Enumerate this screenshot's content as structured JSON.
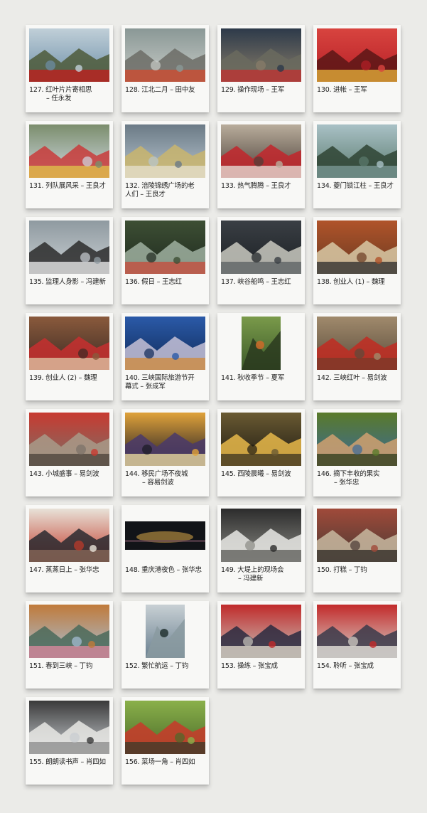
{
  "items": [
    {
      "num": "127.",
      "title": "红叶片片寄相思",
      "author": "任永发",
      "l1": "127. 红叶片片寄相思",
      "l2": "– 任永发",
      "icon": "photo-icon",
      "theme": [
        "#6d8fa8",
        "#c0cfd8",
        "#4d5a3a",
        "#c41b1b"
      ]
    },
    {
      "num": "128.",
      "title": "江北二月",
      "author": "田中友",
      "l1": "128. 江北二月 – 田中友",
      "l2": "",
      "icon": "photo-icon",
      "theme": [
        "#c9ccc8",
        "#8a9896",
        "#6c6c66",
        "#d34a2c"
      ]
    },
    {
      "num": "129.",
      "title": "操作现场",
      "author": "王军",
      "l1": "129. 操作现场 – 王军",
      "l2": "",
      "icon": "photo-icon",
      "theme": [
        "#8a7e6a",
        "#2d3a4a",
        "#6a6a5e",
        "#c22f2f"
      ]
    },
    {
      "num": "130.",
      "title": "进帐",
      "author": "王军",
      "l1": "130. 进帐 – 王军",
      "l2": "",
      "icon": "photo-icon",
      "theme": [
        "#b51f26",
        "#d8443f",
        "#5b1616",
        "#e7b33a"
      ]
    },
    {
      "num": "131.",
      "title": "列队展风采",
      "author": "王良才",
      "l1": "131. 列队展风采 – 王良才",
      "l2": "",
      "icon": "photo-icon",
      "theme": [
        "#cfd9e2",
        "#7b8d6c",
        "#c93b3b",
        "#e0c64a"
      ]
    },
    {
      "num": "132.",
      "title": "涪陵锦绣广场的老人们",
      "author": "王良才",
      "l1": "132. 涪陵锦绣广场的老",
      "l2": "人们 – 王良才",
      "l2left": true,
      "icon": "photo-icon",
      "theme": [
        "#b8c6cf",
        "#6b7a86",
        "#c9b56d",
        "#e6e0cf"
      ]
    },
    {
      "num": "133.",
      "title": "热气腾腾",
      "author": "王良才",
      "l1": "133. 热气腾腾 – 王良才",
      "l2": "",
      "icon": "photo-icon",
      "theme": [
        "#4a3f38",
        "#b9ad9c",
        "#c2262c",
        "#e8e4dc"
      ]
    },
    {
      "num": "134.",
      "title": "夔门锁江柱",
      "author": "王良才",
      "l1": "134. 夔门锁江柱 – 王良才",
      "l2": "",
      "icon": "photo-icon",
      "theme": [
        "#5b7b6e",
        "#a9c1c6",
        "#2f4434",
        "#7e9c9a"
      ]
    },
    {
      "num": "135.",
      "title": "监理人身影",
      "author": "冯建新",
      "l1": "135. 监理人身影 – 冯建新",
      "l2": "",
      "icon": "photo-icon",
      "theme": [
        "#c9cfd3",
        "#8f9aa0",
        "#2c2c2c",
        "#efefef"
      ]
    },
    {
      "num": "136.",
      "title": "假日",
      "author": "王志红",
      "l1": "136. 假日 – 王志红",
      "l2": "",
      "icon": "photo-icon",
      "theme": [
        "#1f2a1f",
        "#3d4f34",
        "#9fb0a0",
        "#c84a3a"
      ]
    },
    {
      "num": "137.",
      "title": "峡谷船鸣",
      "author": "王志红",
      "l1": "137. 峡谷船鸣 – 王志红",
      "l2": "",
      "icon": "photo-icon",
      "theme": [
        "#1b1f24",
        "#3a3f44",
        "#c9c9c0",
        "#5a5f62"
      ]
    },
    {
      "num": "138.",
      "title": "创业人 (1)",
      "author": "魏理",
      "l1": "138. 创业人 (1) – 魏理",
      "l2": "",
      "icon": "photo-icon",
      "theme": [
        "#6b3a22",
        "#b0542a",
        "#d8c9a6",
        "#2a2a2a"
      ]
    },
    {
      "num": "139.",
      "title": "创业人 (2)",
      "author": "魏理",
      "l1": "139. 创业人 (2) – 魏理",
      "l2": "",
      "icon": "photo-icon",
      "theme": [
        "#3b2a24",
        "#8a5a3c",
        "#c72f2f",
        "#e0c9a8"
      ]
    },
    {
      "num": "140.",
      "title": "三峡国际旅游节开幕式",
      "author": "张成军",
      "l1": "140. 三峡国际旅游节开",
      "l2": "幕式 – 张成军",
      "l2left": true,
      "icon": "photo-icon",
      "theme": [
        "#0f2a58",
        "#2b5aa8",
        "#c6c1d6",
        "#d08a3a"
      ]
    },
    {
      "num": "141.",
      "title": "秋收季节",
      "author": "夏军",
      "l1": "141. 秋收季节 – 夏军",
      "l2": "",
      "icon": "photo-icon",
      "theme": [
        "#3c5a2a",
        "#7a9a4a",
        "#c76a2a",
        "#2a3a1e"
      ],
      "narrow": true
    },
    {
      "num": "142.",
      "title": "三峡红叶",
      "author": "易剑波",
      "l1": "142. 三峡红叶 – 易剑波",
      "l2": "",
      "icon": "photo-icon",
      "theme": [
        "#5a4a3a",
        "#a08a6c",
        "#c12b22",
        "#7a3a2a"
      ]
    },
    {
      "num": "143.",
      "title": "小城盛事",
      "author": "易剑波",
      "l1": "143. 小城盛事 – 易剑波",
      "l2": "",
      "icon": "photo-icon",
      "theme": [
        "#7a7068",
        "#c83a30",
        "#a89a88",
        "#4a4038"
      ]
    },
    {
      "num": "144.",
      "title": "移民广场不夜城",
      "author": "容易剑波",
      "l1": "144. 移民广场不夜城",
      "l2": "– 容易剑波",
      "icon": "photo-icon",
      "theme": [
        "#1a1a24",
        "#e0a23a",
        "#4a3a6a",
        "#f0e0a0"
      ]
    },
    {
      "num": "145.",
      "title": "西陵晨曦",
      "author": "易剑波",
      "l1": "145. 西陵晨曦 – 易剑波",
      "l2": "",
      "icon": "photo-icon",
      "theme": [
        "#1e1a12",
        "#6a5a32",
        "#e8b84a",
        "#3a3220"
      ]
    },
    {
      "num": "146.",
      "title": "摘下丰收的果实",
      "author": "张华忠",
      "l1": "146. 摘下丰收的果实",
      "l2": "– 张华忠",
      "icon": "photo-icon",
      "theme": [
        "#3a6a9a",
        "#5a7a2a",
        "#d0a070",
        "#2a3a1a"
      ]
    },
    {
      "num": "147.",
      "title": "蒸蒸日上",
      "author": "张华忠",
      "l1": "147. 蒸蒸日上 – 张华忠",
      "l2": "",
      "icon": "photo-icon",
      "theme": [
        "#c23a2a",
        "#e8e2d8",
        "#2a2a30",
        "#8a6a5a"
      ]
    },
    {
      "num": "148.",
      "title": "重庆港夜色",
      "author": "张华忠",
      "l1": "148. 重庆港夜色 – 张华忠",
      "l2": "",
      "icon": "photo-icon",
      "theme": [
        "#121418",
        "#3a3040",
        "#d8a848",
        "#6a4a5a"
      ],
      "banner": true
    },
    {
      "num": "149.",
      "title": "大堤上的现场会",
      "author": "冯建新",
      "l1": "149. 大堤上的现场会",
      "l2": "– 冯建新",
      "icon": "photo-icon",
      "theme": [
        "#8a8a84",
        "#2c2c2c",
        "#e8e8e4",
        "#5a5a56"
      ]
    },
    {
      "num": "150.",
      "title": "打糕",
      "author": "丁钧",
      "l1": "150. 打糕 – 丁钧",
      "l2": "",
      "icon": "photo-icon",
      "theme": [
        "#4a3a34",
        "#a04a3a",
        "#c8b8a0",
        "#2a2420"
      ]
    },
    {
      "num": "151.",
      "title": "春到三峡",
      "author": "丁钧",
      "l1": "151. 春到三峡 – 丁钧",
      "l2": "",
      "icon": "photo-icon",
      "theme": [
        "#a8c0d8",
        "#c07a3a",
        "#4a6a5a",
        "#e08aa0"
      ]
    },
    {
      "num": "152.",
      "title": "繁忙航运",
      "author": "丁钧",
      "l1": "152. 繁忙航运 – 丁钧",
      "l2": "",
      "icon": "photo-icon",
      "theme": [
        "#6a8090",
        "#c8d0d4",
        "#2a3a3a",
        "#8a9aa0"
      ],
      "narrow": true
    },
    {
      "num": "153.",
      "title": "操练",
      "author": "张宝成",
      "l1": "153. 操练 – 张宝成",
      "l2": "",
      "icon": "photo-icon",
      "theme": [
        "#c8c4bc",
        "#c02a2a",
        "#2a2a40",
        "#e8e0d0"
      ]
    },
    {
      "num": "154.",
      "title": "聆听",
      "author": "张宝成",
      "l1": "154. 聆听 – 张宝成",
      "l2": "",
      "icon": "photo-icon",
      "theme": [
        "#d8d4cc",
        "#c22a2a",
        "#3a3a4a",
        "#f0ece4"
      ]
    },
    {
      "num": "155.",
      "title": "朗朗读书声",
      "author": "肖四如",
      "l1": "155. 朗朗读书声 – 肖四如",
      "l2": "",
      "icon": "photo-icon",
      "theme": [
        "#c8ccd0",
        "#3a3a3a",
        "#e8e8e4",
        "#8a8a8a"
      ]
    },
    {
      "num": "156.",
      "title": "菜场一角",
      "author": "肖四如",
      "l1": "156. 菜场一角 – 肖四如",
      "l2": "",
      "icon": "photo-icon",
      "theme": [
        "#4a6a2a",
        "#8ab04a",
        "#c83a2a",
        "#3a3a2a"
      ]
    }
  ]
}
